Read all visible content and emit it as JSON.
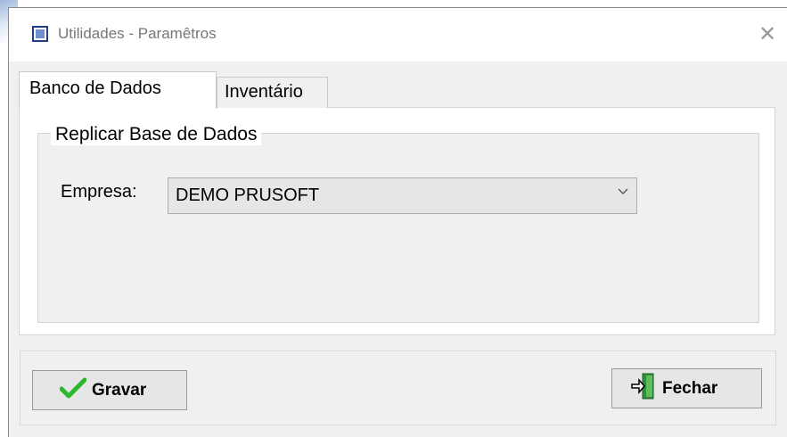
{
  "window": {
    "title": "Utilidades - Paramêtros",
    "close_glyph": "✕",
    "icon": "app-window-icon"
  },
  "tabs": [
    {
      "label": "Banco de Dados",
      "active": true
    },
    {
      "label": "Inventário",
      "active": false
    }
  ],
  "group": {
    "legend": "Replicar Base de Dados",
    "empresa_label": "Empresa:",
    "empresa_value": "DEMO PRUSOFT",
    "dropdown_icon": "chevron-down-icon"
  },
  "buttons": {
    "gravar_label": "Gravar",
    "gravar_icon": "checkmark-icon",
    "fechar_label": "Fechar",
    "fechar_icon": "exit-door-icon"
  },
  "colors": {
    "check": "#2db82d",
    "exit_green": "#2f8f3a",
    "window_icon": "#1b3f8a"
  }
}
